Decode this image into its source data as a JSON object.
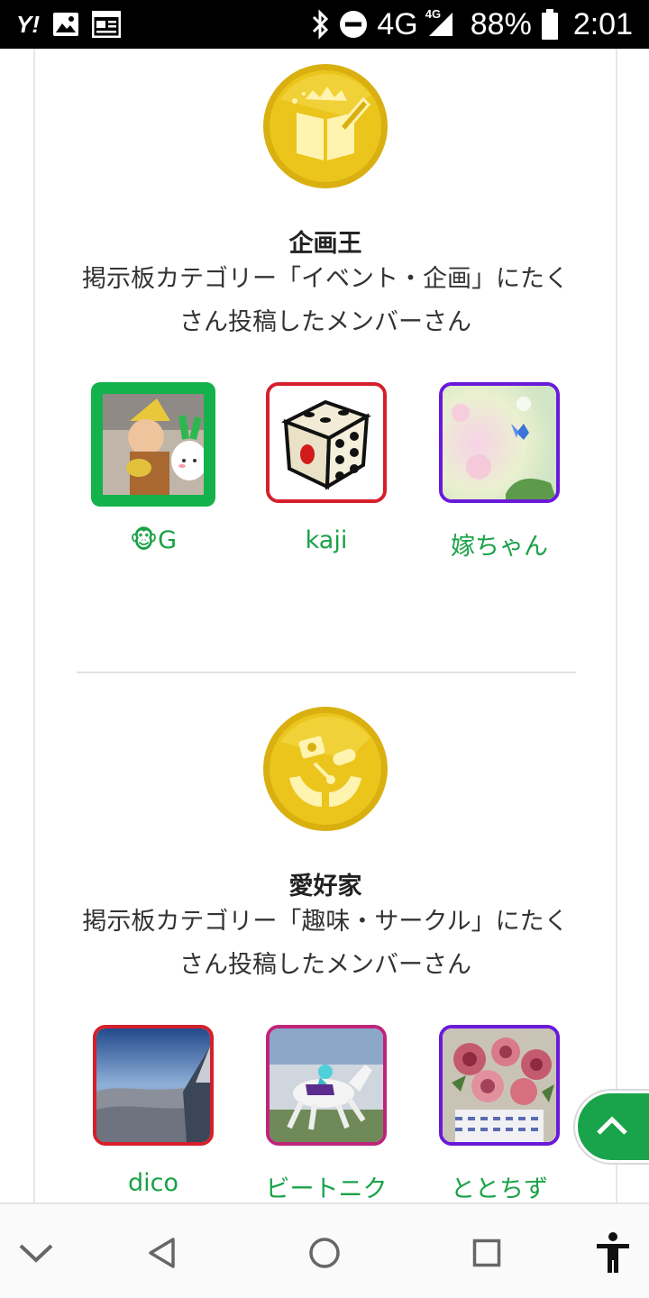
{
  "status_bar": {
    "left_icons": [
      "yahoo-icon",
      "image-icon",
      "news-icon"
    ],
    "right_icons": [
      "bluetooth-icon",
      "do-not-disturb-icon",
      "signal-icon",
      "battery-icon"
    ],
    "network": "4G",
    "network_small": "4G",
    "battery": "88%",
    "time": "2:01"
  },
  "sections": [
    {
      "medal_icon": "book-crown-pen-icon",
      "title": "企画王",
      "description": "掲示板カテゴリー「イベント・企画」にたくさん投稿したメンバーさん",
      "members": [
        {
          "name": "🐵G",
          "border_color": "#14b24a"
        },
        {
          "name": "kaji",
          "border_color": "#d51f2b"
        },
        {
          "name": "嫁ちゃん",
          "border_color": "#6a19d9"
        }
      ]
    },
    {
      "medal_icon": "hobby-hands-icon",
      "title": "愛好家",
      "description": "掲示板カテゴリー「趣味・サークル」にたくさん投稿したメンバーさん",
      "members": [
        {
          "name": "dico",
          "border_color": "#d51f2b"
        },
        {
          "name": "ビートニク",
          "border_color": "#c0247a"
        },
        {
          "name": "ととちず",
          "border_color": "#6a19d9"
        }
      ]
    }
  ],
  "colors": {
    "accent_green": "#1aa147",
    "medal_gold": "#e8c31a"
  },
  "nav_bar": [
    "chevron-down-icon",
    "back-icon",
    "home-icon",
    "recents-icon",
    "accessibility-icon"
  ]
}
